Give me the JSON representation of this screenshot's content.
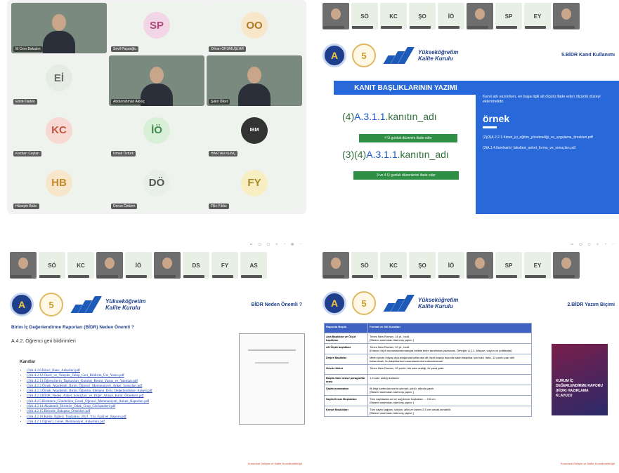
{
  "meeting": {
    "tiles": [
      {
        "name": "M.Cem Bakalım",
        "initials": "",
        "type": "camera"
      },
      {
        "name": "Sevil Paşaoğlu",
        "initials": "SP",
        "color": "#f3d6e6",
        "text": "#b0487a"
      },
      {
        "name": "Orhan OKUMUŞLAR",
        "initials": "OO",
        "color": "#f7e6c9",
        "text": "#b07a28"
      },
      {
        "name": "Ebide İladen",
        "initials": "Eİ",
        "color": "#e4ece4",
        "text": "#6b6b6b"
      },
      {
        "name": "Abdurrahman Akküç",
        "initials": "",
        "type": "camera"
      },
      {
        "name": "Şakir Ülker",
        "initials": "",
        "type": "camera"
      },
      {
        "name": "Kezban Ceylan",
        "initials": "KC",
        "color": "#f8d8d2",
        "text": "#c25540"
      },
      {
        "name": "İsmail Öztürk",
        "initials": "İÖ",
        "color": "#d8f0d8",
        "text": "#3f8a4a"
      },
      {
        "name": "HAKTAN KUNÇ",
        "initials": "",
        "type": "logo"
      },
      {
        "name": "Hüseyin Balcı",
        "initials": "HB",
        "color": "#f7e6c9",
        "text": "#c48a2c"
      },
      {
        "name": "Derun Öztürm",
        "initials": "DÖ",
        "color": "#e8eee8",
        "text": "#555"
      },
      {
        "name": "Filiz Yıldız",
        "initials": "FY",
        "color": "#f7efc2",
        "text": "#a7892a"
      }
    ]
  },
  "q2": {
    "strip": [
      "",
      "SÖ",
      "KC",
      "ŞO",
      "İÖ",
      "",
      "SP",
      "EY",
      ""
    ],
    "brand": "Yükseköğretim\nKalite Kurulu",
    "section": "5.BİDR Kanıt Kullanımı",
    "banner": "KANIT BAŞLIKLARININ YAZIMI",
    "code1_prefix": "(4)",
    "code1_body": "A.3.1.1",
    "code1_suffix": ".kanıtın_adı",
    "bar1": "4 Ü gunluk düzenini ifade eder",
    "code2_prefix": "(3)(4)",
    "code2_body": "A.3.1.1",
    "code2_suffix": ".kanıtın_adı",
    "bar2": "3 ve 4 Ü gunluk düzenlerini ifade eder",
    "panel_intro": "Kanıt adı yazılırken, en başa ilgili alt ölçütü ifade eden ölçünlü düzeyi eklenmelidir.",
    "panel_heading": "örnek",
    "panel_ex1": "(2)(3)A.2.2.1.Kimet_içi_eğitim_yönetmeliği_ve_uygulama_örnekleri.pdf",
    "panel_ex2": "(3)A.1.4.Ilumlnarbi_fakultesi_anket_formu_ve_sonuçları.pdf"
  },
  "q3": {
    "strip": [
      "",
      "SÖ",
      "KC",
      "",
      "İÖ",
      "",
      "DS",
      "FY",
      "AS"
    ],
    "brand": "Yükseköğretim\nKalite Kurulu",
    "section": "BİDR Neden Önemli ?",
    "heading": "Birim İç Değerlendirme Raporları (BİDR) Neden Önemli ?",
    "subheading": "A.4.2. Öğrenci geri bildirimleri",
    "links_title": "Kanıtlar",
    "links": [
      "(3)A.4.2.6.İkinci_Hane_Anketleri.pdf",
      "(3)A.4.2.12.Öneri_ve_Talepler_Takip_Geri_Bildirim_Üst_Yazısı.pdf",
      "(3)A.4.2.13.Öğrencilerin_Taşıkayları_Kuruluş_Resmi_Yazısı_ve_Yanıtları.pdf",
      "(3)A.4.2.2.Örnek_Akademik_Birim_Öğrenci_Memnuniyeti_Anket_Sonuçları.pdf",
      "(3)A.4.2.3.Örnek_Akademik_Birim_Öğretim_Elemanı_Ders_Değerlendirme_Anketi.pdf",
      "(3)A.4.2.4.BİDR_Neden_Anket_Sonuçları_ve_Diğer_Alınan_Karar_Örnekleri.pdf",
      "(4)A.4.2.5.Birimlere_Gönderilen_Genel_Öğrenci_Memnuniyeti_Anketi_Raporları.pdf",
      "(4)A.4.2.14.Akademik_Birimler_Odak_Grup_Görüşmeleri.pdf",
      "(4)A.4.2.15.Birimde_Bakışma_Örnekleri.pdf",
      "(3)A.4.2.16.Kalite_İlgileri_Toplantısı_2021_Yılı_Faaliyet_Raporu.pdf",
      "(3)A.4.2.1.Öğrenci_Genel_Memnuniyet_Anketinin.pdf"
    ],
    "footer": "Kurumsal Gelişim ve Kalite Koordinatörlüğü"
  },
  "q4": {
    "strip": [
      "",
      "SÖ",
      "KC",
      "ŞO",
      "İÖ",
      "",
      "SP",
      "EY",
      ""
    ],
    "brand": "Yükseköğretim\nKalite Kurulu",
    "section": "2.BİDR Yazım Biçimi",
    "table": [
      [
        "Raporda Başlık",
        "Format ve Stil Kuralları"
      ],
      [
        "Ana Başlıklar ve Ölçüt başlıkları",
        "Times New Roman, 14 pt., bold.\n[Sistem tarafından ödenmiş yapılır.]"
      ],
      [
        "Alt Ölçüt başlıkları",
        "Times New Roman, 12 pt., bold.\n[Kılavuz ölçüt numaralandırmasıyla birlikte birim tarafından yazılacak. Örneğin: A.2.1. Misyon, vizyon ve politikalar]"
      ],
      [
        "Değer Başlıklar",
        "Metin içinde ihtiyaç duyulduğunda kullanılan alt ölçüt başlığı dışında kalan başlıklar için bold, italic, 12 punto yazı stili kullanılmalı, bu başlıklarda numaralandırma kullanılmamalı."
      ],
      [
        "Gövde Metni",
        "Times New Roman, 12 punto, tek satır aralığı, iki yana yaslı"
      ],
      [
        "Başlık-Satır arası/ paragraflar arası",
        "1,5 satır aralığı kullanılır"
      ],
      [
        "Sayfa numaraları",
        "İlk bilgi kartından sonra çıkmalı, yönlü, altında yazılı.\n[Sistem tarafından ödenmiş yapılır.]"
      ],
      [
        "Sayfa Kenar Boşlukları",
        "Tüm sayfalarda sol ve sağ kenar boşlukları ... 2,5 cm.\n[Sistem tarafından ödenmiş yapılır.]"
      ],
      [
        "Kenar Boşlukları",
        "Tüm sayfa sağdan, soldan, altta ve üstten 2,5 cm olarak alınabilir.\n[Sistem tarafından ödenmiş yapılır.]"
      ]
    ],
    "book": "KURUM İÇ DEĞERLENDİRME RAPORU (KİDR) HAZIRLAMA KLAVUZU",
    "footer": "Kurumsal Gelişim ve Kalite Koordinatörlüğü"
  }
}
